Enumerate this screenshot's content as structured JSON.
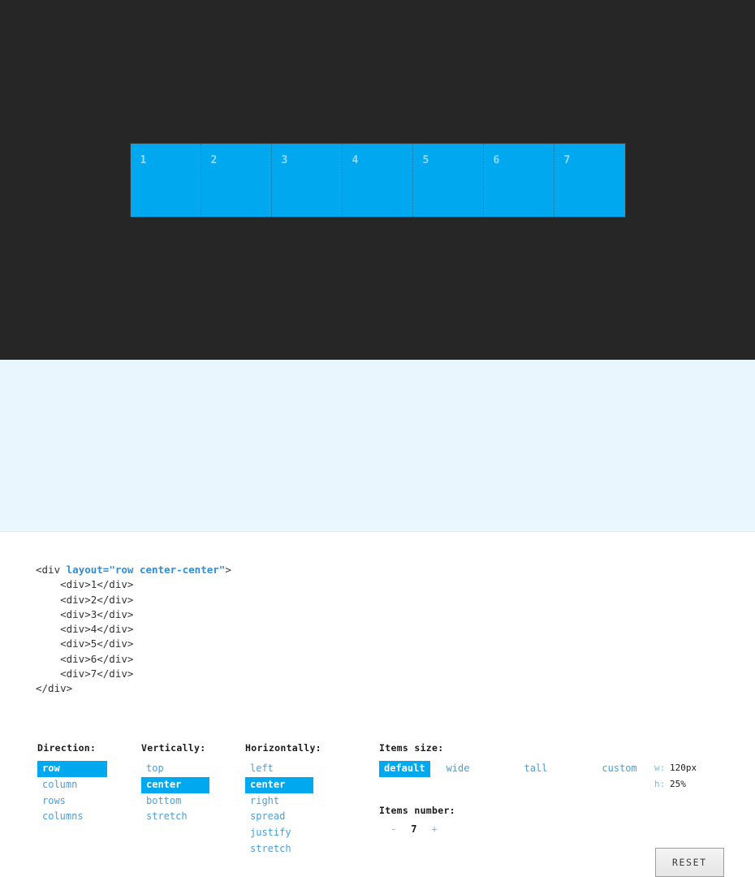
{
  "stage": {
    "background_color": "#262626",
    "item_color": "#00a8ef",
    "item_label_color": "#8fd9f8",
    "items": [
      "1",
      "2",
      "3",
      "4",
      "5",
      "6",
      "7"
    ]
  },
  "controls": {
    "background_color": "#eaf6fd",
    "accent_color": "#00a8ef",
    "direction": {
      "label": "Direction:",
      "options": [
        "row",
        "column",
        "rows",
        "columns"
      ],
      "selected": "row"
    },
    "vertically": {
      "label": "Vertically:",
      "options": [
        "top",
        "center",
        "bottom",
        "stretch"
      ],
      "selected": "center"
    },
    "horizontally": {
      "label": "Horizontally:",
      "options": [
        "left",
        "center",
        "right",
        "spread",
        "justify",
        "stretch"
      ],
      "selected": "center"
    },
    "items_size": {
      "label": "Items size:",
      "options": [
        "default",
        "wide",
        "tall",
        "custom"
      ],
      "selected": "default",
      "width_label": "w:",
      "width_value": "120px",
      "height_label": "h:",
      "height_value": "25%"
    },
    "items_number": {
      "label": "Items number:",
      "decrement": "-",
      "value": "7",
      "increment": "+"
    },
    "reset": {
      "label": "RESET"
    }
  },
  "code": {
    "open_tag_prefix": "<div ",
    "attribute": "layout=\"row center-center\"",
    "open_tag_suffix": ">",
    "child_lines": [
      "    <div>1</div>",
      "    <div>2</div>",
      "    <div>3</div>",
      "    <div>4</div>",
      "    <div>5</div>",
      "    <div>6</div>",
      "    <div>7</div>"
    ],
    "close_tag": "</div>"
  }
}
